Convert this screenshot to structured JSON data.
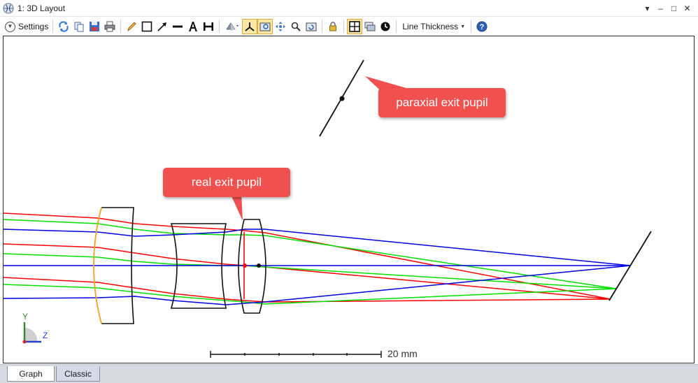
{
  "window": {
    "title": "1: 3D Layout",
    "controls": [
      "▾",
      "–",
      "□",
      "✕"
    ]
  },
  "toolbar": {
    "settings_label": "Settings",
    "line_thickness_label": "Line Thickness",
    "icons": [
      "refresh-icon",
      "copy-icon",
      "save-icon",
      "print-icon",
      "pencil-icon",
      "rectangle-icon",
      "arrow-icon",
      "line-icon",
      "text-icon",
      "dimension-icon",
      "rotate-view-icon",
      "axes-icon",
      "zoom-to-fit-icon",
      "pan-icon",
      "zoom-icon",
      "reset-view-icon",
      "lock-icon",
      "fit-window-icon",
      "layers-icon",
      "timer-icon",
      "help-icon"
    ]
  },
  "callouts": {
    "paraxial": "paraxial exit pupil",
    "real": "real exit pupil"
  },
  "axes": {
    "y": "Y",
    "z": "Z"
  },
  "scale_bar": {
    "label": "20 mm"
  },
  "tabs": [
    {
      "label": "Graph",
      "active": true
    },
    {
      "label": "Classic",
      "active": false
    }
  ],
  "colors": {
    "ray_red": "#ff0000",
    "ray_green": "#00e000",
    "ray_blue": "#0000e0",
    "callout": "#f0514f",
    "lens_orange": "#f5a028",
    "active_tool": "#fde7a6"
  }
}
